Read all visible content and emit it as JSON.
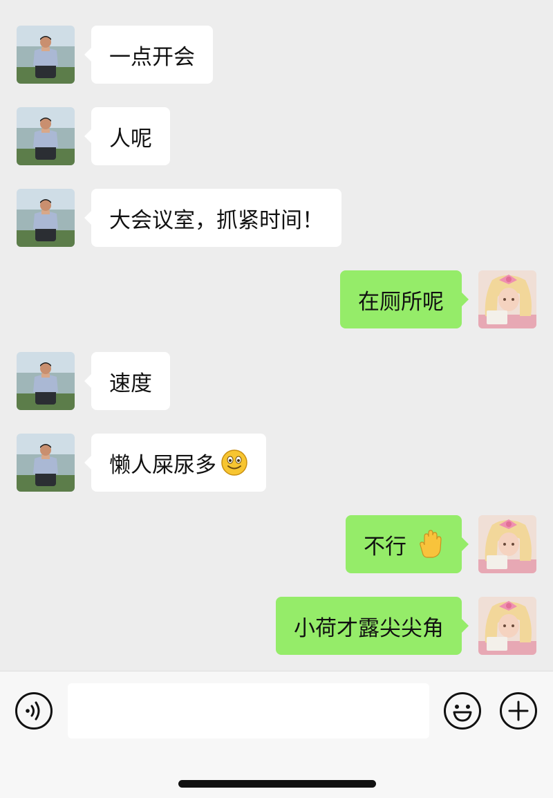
{
  "messages": [
    {
      "side": "left",
      "text": "一点开会",
      "sender": "contact"
    },
    {
      "side": "left",
      "text": "人呢",
      "sender": "contact"
    },
    {
      "side": "left",
      "text": "大会议室，抓紧时间！",
      "sender": "contact"
    },
    {
      "side": "right",
      "text": "在厕所呢",
      "sender": "me"
    },
    {
      "side": "left",
      "text": "速度",
      "sender": "contact"
    },
    {
      "side": "left",
      "text": "懒人屎尿多",
      "emoji": "smiling-face-emoji",
      "sender": "contact"
    },
    {
      "side": "right",
      "text": "不行",
      "emoji": "raised-hand-emoji",
      "sender": "me"
    },
    {
      "side": "right",
      "text": "小荷才露尖尖角",
      "sender": "me"
    }
  ],
  "input_bar": {
    "input_value": "",
    "voice_icon": "voice-icon",
    "emoji_icon": "emoji-icon",
    "plus_icon": "plus-icon"
  },
  "colors": {
    "background": "#ededed",
    "incoming_bubble": "#ffffff",
    "outgoing_bubble": "#95ec69",
    "bottom_bar": "#f7f7f7"
  }
}
